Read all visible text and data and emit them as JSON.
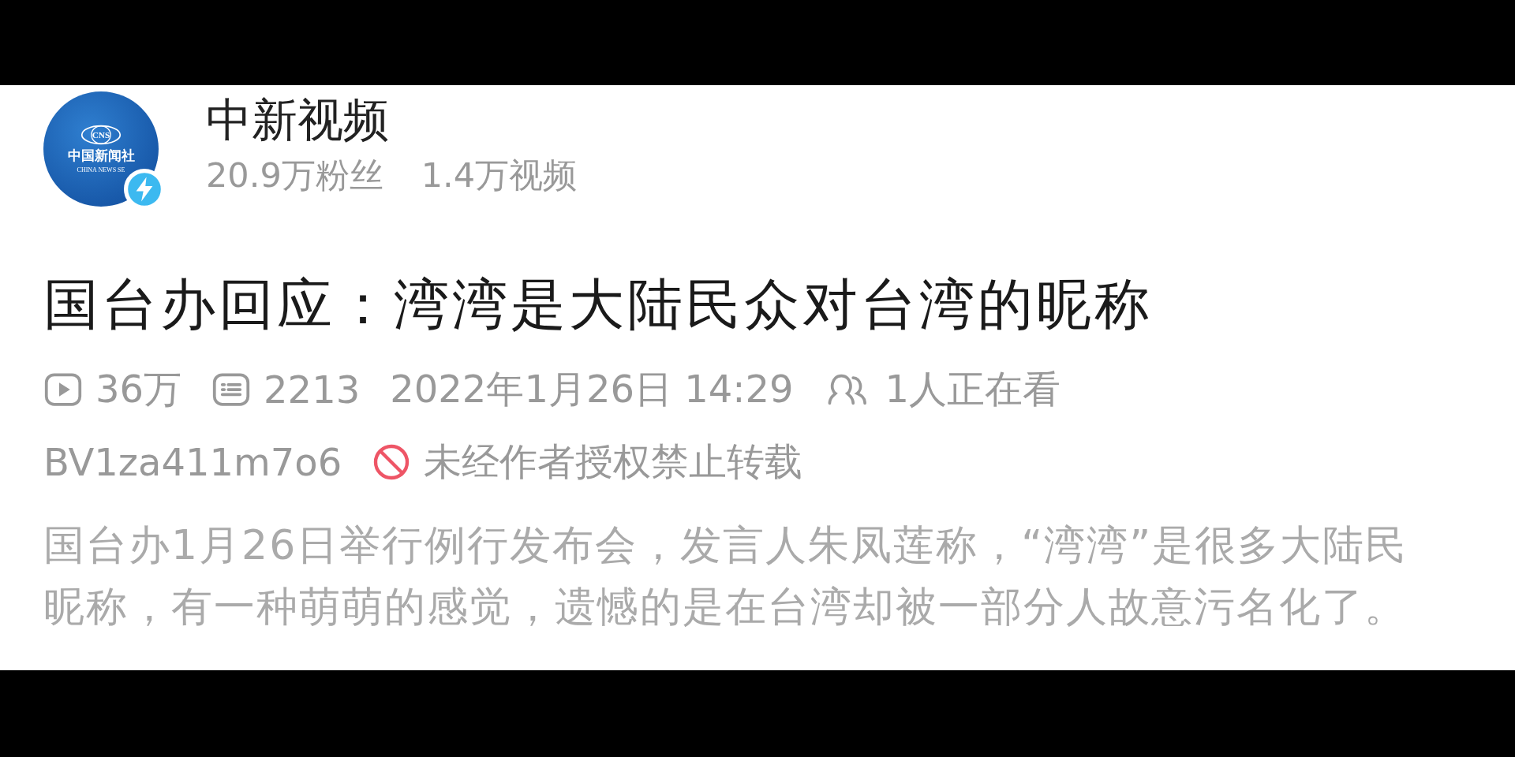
{
  "channel": {
    "name": "中新视频",
    "followers": "20.9万粉丝",
    "videos": "1.4万视频",
    "verified": true,
    "avatar": {
      "emblem": "CNS",
      "title": "中国新闻社",
      "subtitle": "CHINA NEWS SE"
    }
  },
  "video": {
    "title": "国台办回应：湾湾是大陆民众对台湾的昵称",
    "stats": [
      {
        "kind": "views",
        "text": "36万"
      },
      {
        "kind": "danmaku",
        "text": "2213"
      },
      {
        "kind": "date",
        "text": "2022年1月26日 14:29"
      },
      {
        "kind": "watching",
        "text": "1人正在看"
      }
    ],
    "bvid": "BV1za411m7o6",
    "reprint_notice": "未经作者授权禁止转载",
    "description": [
      "国台办1月26日举行例行发布会，发言人朱凤莲称，“湾湾”是很多大陆民",
      "昵称，有一种萌萌的感觉，遗憾的是在台湾却被一部分人故意污名化了。"
    ]
  }
}
